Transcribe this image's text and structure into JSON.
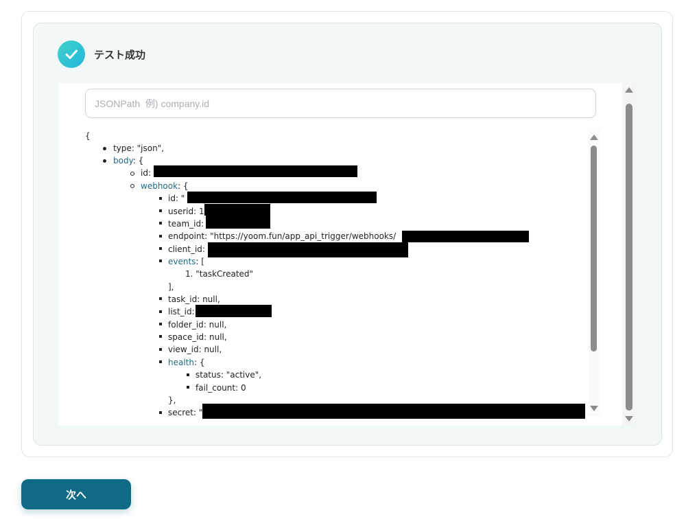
{
  "status": {
    "text": "テスト成功",
    "icon": "check-circle-icon",
    "color_from": "#3fd2c4",
    "color_to": "#25b6e0"
  },
  "search": {
    "placeholder": "JSONPath  例) company.id",
    "value": ""
  },
  "json_tree": {
    "open_brace": "{",
    "type_entry": "type: \"json\",",
    "body_key": "body",
    "body_open": ": {",
    "body_id_label": "id: ",
    "webhook_key": "webhook",
    "webhook_open": ": {",
    "webhook_id_label": "id: \"",
    "userid_label": "userid: 1",
    "team_id_label": "team_id: ",
    "endpoint_label": "endpoint: \"https://yoom.fun/app_api_trigger/webhooks/",
    "client_id_label": "client_id: ",
    "events_key": "events",
    "events_open": ": [",
    "events_item": "1. \"taskCreated\"",
    "events_close": "],",
    "task_id": "task_id: null,",
    "list_id_label": "list_id: ",
    "folder_id": "folder_id: null,",
    "space_id": "space_id: null,",
    "view_id": "view_id: null,",
    "health_key": "health",
    "health_open": ": {",
    "health_status": "status: \"active\",",
    "health_fail_count": "fail_count: 0",
    "health_close": "},",
    "secret_label": "secret: \""
  },
  "colors": {
    "accent": "#0f6b85",
    "json_key": "#1e6b84",
    "panel_bg": "#f1f8f7",
    "redaction": "#000000"
  },
  "footer": {
    "next_label": "次へ"
  }
}
